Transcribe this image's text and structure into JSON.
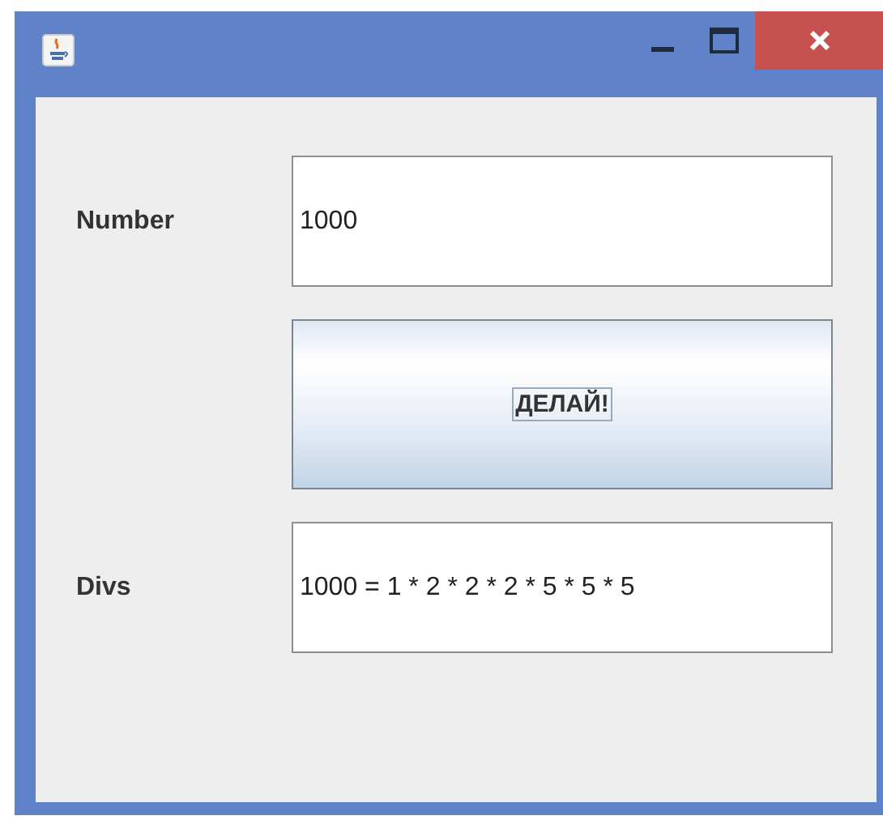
{
  "form": {
    "number_label": "Number",
    "number_value": "1000",
    "action_button": "ДЕЛАЙ!",
    "divs_label": "Divs",
    "divs_value": "1000 = 1 * 2 * 2 * 2 * 5 * 5 * 5"
  }
}
